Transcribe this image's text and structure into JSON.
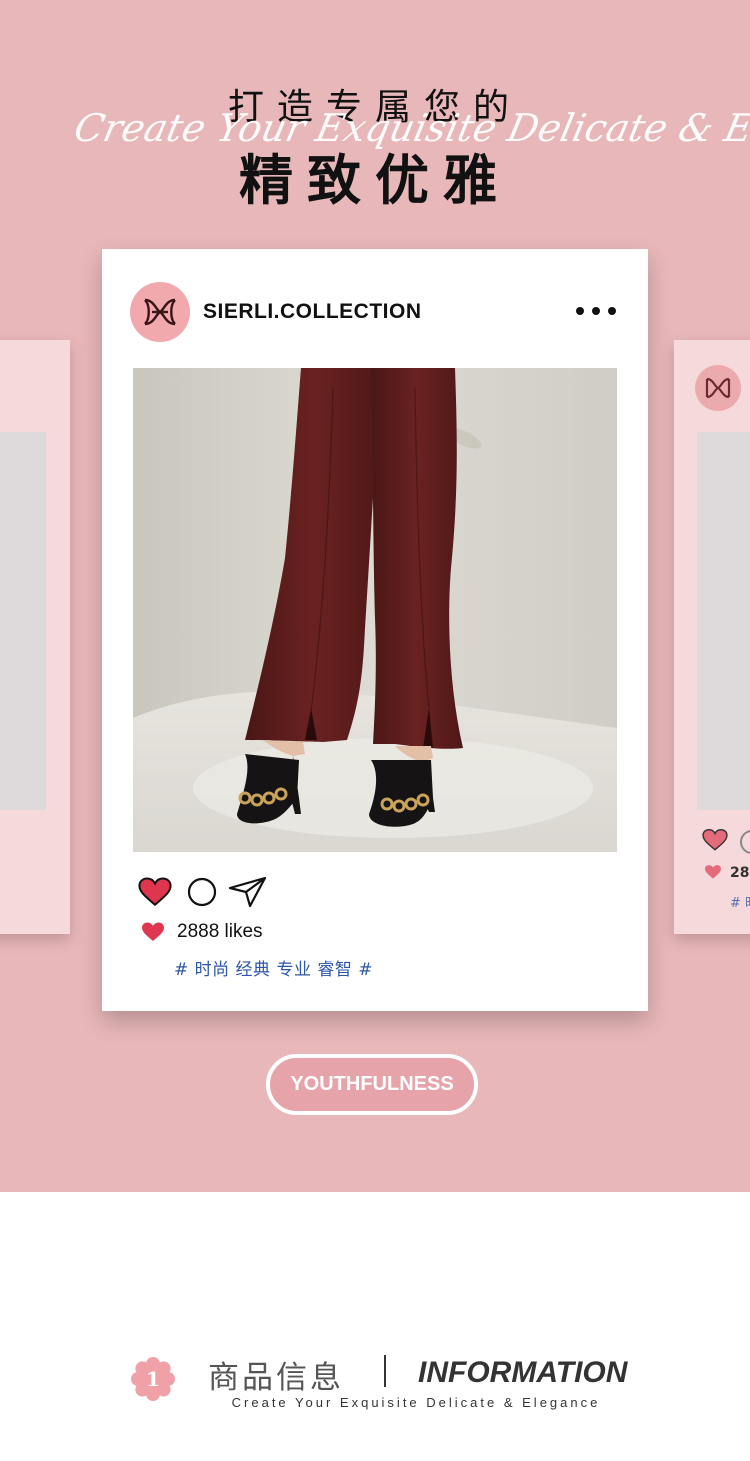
{
  "hero": {
    "title_line1": "打造专属您的",
    "script_text": "Create Your Exquisite Delicate & Elegance",
    "title_line2": "精致优雅"
  },
  "post": {
    "account_name": "SIERLI.COLLECTION",
    "menu_icon": "more-dots-icon",
    "actions": [
      "heart-icon",
      "comment-icon",
      "share-icon"
    ],
    "likes_text": "2888 likes",
    "hashtags": "# 时尚 经典 专业 睿智 #"
  },
  "side_card_right": {
    "likes_text": "28",
    "tag_text": "# 时"
  },
  "badge": {
    "label": "YOUTHFULNESS"
  },
  "section": {
    "number": "1",
    "title_cn": "商品信息",
    "title_en": "INFORMATION",
    "subtitle": "Create Your Exquisite Delicate & Elegance"
  },
  "colors": {
    "hero_bg": "#e8b7b9",
    "heart": "#e0354e",
    "hashtag": "#2d57a8",
    "pill_bg": "#e6a3a9"
  }
}
